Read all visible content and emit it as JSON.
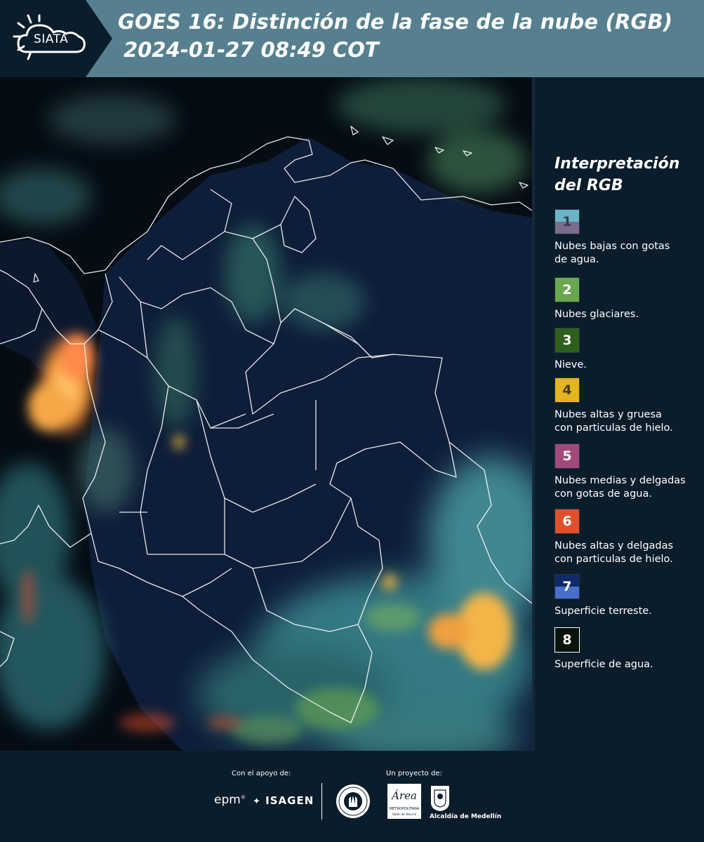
{
  "header": {
    "title_line1": "GOES 16: Distinción de la fase de la nube (RGB)",
    "title_line2": "2024-01-27 08:49 COT",
    "logo_text": "SIATA",
    "colors": {
      "bar": "#56808f",
      "logo_bg": "#0b1d2b"
    }
  },
  "map": {
    "icon": "satellite-rgb-map",
    "colors": {
      "ocean": "#050c14",
      "land": "#0f1f3d",
      "border": "#ffffff",
      "convective": "#f79b3a",
      "low_cloud": "#3d8fa0"
    }
  },
  "legend": {
    "title_line1": "Interpretación",
    "title_line2": "del RGB",
    "items": [
      {
        "number": "1",
        "label_line1": "Nubes bajas con gotas",
        "label_line2": "de agua.",
        "color_top": "#6ab6c7",
        "color_bottom": "#7b6d8d",
        "num_color": "#3b3b4a"
      },
      {
        "number": "2",
        "label_line1": "Nubes glaciares.",
        "label_line2": "",
        "color_top": "#6aa84f",
        "color_bottom": "#6aa84f",
        "num_color": "#ffffff"
      },
      {
        "number": "3",
        "label_line1": "Nieve.",
        "label_line2": "",
        "color_top": "#2f5f1c",
        "color_bottom": "#2f5f1c",
        "num_color": "#ffffff"
      },
      {
        "number": "4",
        "label_line1": "Nubes altas y gruesa",
        "label_line2": "con particulas de hielo.",
        "color_top": "#e5b51f",
        "color_bottom": "#e5b51f",
        "num_color": "#4a3a10"
      },
      {
        "number": "5",
        "label_line1": "Nubes medias y delgadas",
        "label_line2": "con gotas de agua.",
        "color_top": "#a14a7a",
        "color_bottom": "#a14a7a",
        "num_color": "#ffffff"
      },
      {
        "number": "6",
        "label_line1": "Nubes altas y delgadas",
        "label_line2": "con particulas de hielo.",
        "color_top": "#e2502b",
        "color_bottom": "#e2502b",
        "num_color": "#ffffff"
      },
      {
        "number": "7",
        "label_line1": "Superficie terreste.",
        "label_line2": "",
        "color_top": "#0f2a6a",
        "color_bottom": "#4a6fc8",
        "num_color": "#ffffff"
      },
      {
        "number": "8",
        "label_line1": "Superficie de agua.",
        "label_line2": "",
        "color_top": "#06140c",
        "color_bottom": "#06140c",
        "num_color": "#ffffff"
      }
    ]
  },
  "footer": {
    "support_label": "Con el apoyo de:",
    "project_label": "Un proyecto de:",
    "epm": "epm",
    "isagen": "ISAGEN",
    "area_line1": "Área",
    "area_line2": "METROPOLITANA",
    "area_line3": "Valle de Aburrá",
    "alcaldia": "Alcaldía de Medellín"
  }
}
